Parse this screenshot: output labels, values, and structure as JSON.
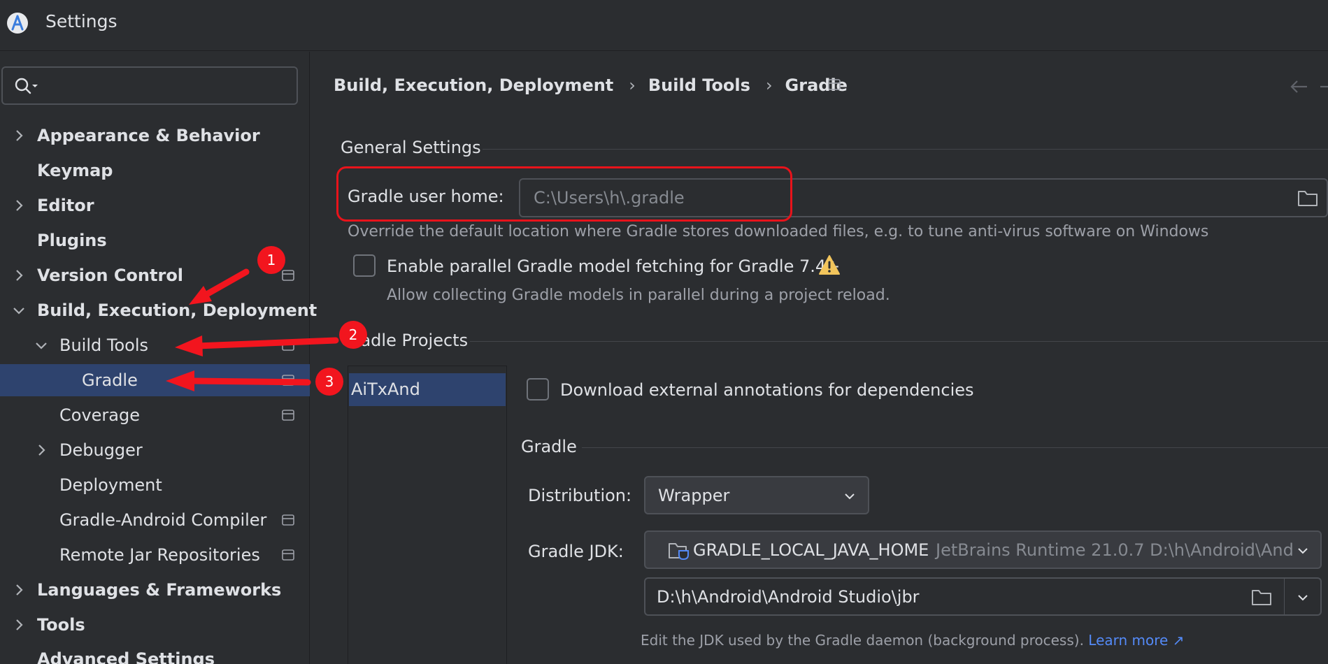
{
  "window": {
    "title": "Settings"
  },
  "search": {
    "placeholder": "",
    "value": ""
  },
  "sidebar": {
    "items": [
      {
        "label": "Appearance & Behavior",
        "expandable": true,
        "expanded": false
      },
      {
        "label": "Keymap",
        "expandable": false
      },
      {
        "label": "Editor",
        "expandable": true,
        "expanded": false
      },
      {
        "label": "Plugins",
        "expandable": false
      },
      {
        "label": "Version Control",
        "expandable": true,
        "expanded": false
      },
      {
        "label": "Build, Execution, Deployment",
        "expandable": true,
        "expanded": true
      },
      {
        "label": "Build Tools",
        "expandable": true,
        "expanded": true
      },
      {
        "label": "Gradle",
        "selected": true
      },
      {
        "label": "Coverage"
      },
      {
        "label": "Debugger",
        "expandable": true,
        "expanded": false
      },
      {
        "label": "Deployment"
      },
      {
        "label": "Gradle-Android Compiler"
      },
      {
        "label": "Remote Jar Repositories"
      },
      {
        "label": "Languages & Frameworks",
        "expandable": true,
        "expanded": false
      },
      {
        "label": "Tools",
        "expandable": true,
        "expanded": false
      },
      {
        "label": "Advanced Settings"
      }
    ]
  },
  "breadcrumb": {
    "items": [
      "Build, Execution, Deployment",
      "Build Tools",
      "Gradle"
    ],
    "separator": "›"
  },
  "general": {
    "title": "General Settings",
    "user_home_label": "Gradle user home:",
    "user_home_placeholder": "C:\\Users\\h\\.gradle",
    "user_home_hint": "Override the default location where Gradle stores downloaded files, e.g. to tune anti-virus software on Windows",
    "parallel_label": "Enable parallel Gradle model fetching for Gradle 7.4+",
    "parallel_checked": false,
    "parallel_hint": "Allow collecting Gradle models in parallel during a project reload."
  },
  "projects": {
    "title": "Gradle Projects",
    "list": [
      "AiTxAnd"
    ],
    "download_annotations_label": "Download external annotations for dependencies",
    "download_annotations_checked": false
  },
  "gradle": {
    "title": "Gradle",
    "distribution_label": "Distribution:",
    "distribution_value": "Wrapper",
    "jdk_label": "Gradle JDK:",
    "jdk_name": "GRADLE_LOCAL_JAVA_HOME",
    "jdk_detail": "JetBrains Runtime 21.0.7 D:\\h\\Android\\And",
    "jdk_path": "D:\\h\\Android\\Android Studio\\jbr",
    "jdk_hint": "Edit the JDK used by the Gradle daemon (background process).",
    "learn_more": "Learn more ↗"
  },
  "annotations": {
    "badge_1": "1",
    "badge_2": "2",
    "badge_3": "3"
  },
  "colors": {
    "background": "#2b2d30",
    "selection": "#2e436e",
    "annotation_red": "#e8131b",
    "link": "#548af7",
    "warning": "#f2c55c"
  }
}
